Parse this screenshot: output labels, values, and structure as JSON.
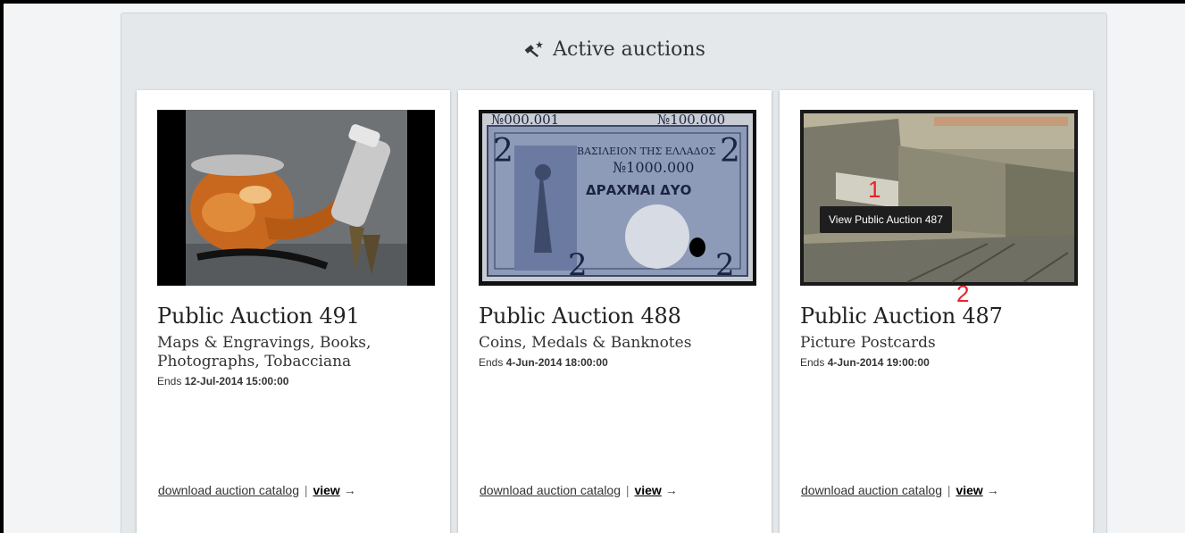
{
  "panel": {
    "title": "Active auctions"
  },
  "cards": [
    {
      "title": "Public Auction 491",
      "subtitle": "Maps & Engravings, Books, Photographs, Tobacciana",
      "ends_label": "Ends",
      "ends_value": "12-Jul-2014 15:00:00",
      "download_label": "download auction catalog",
      "separator": "|",
      "view_label": "view",
      "arrow": "→"
    },
    {
      "title": "Public Auction 488",
      "subtitle": "Coins, Medals & Banknotes",
      "ends_label": "Ends",
      "ends_value": "4-Jun-2014 18:00:00",
      "download_label": "download auction catalog",
      "separator": "|",
      "view_label": "view",
      "arrow": "→"
    },
    {
      "title": "Public Auction 487",
      "subtitle": "Picture Postcards",
      "ends_label": "Ends",
      "ends_value": "4-Jun-2014 19:00:00",
      "download_label": "download auction catalog",
      "separator": "|",
      "view_label": "view",
      "arrow": "→",
      "tooltip": "View Public Auction 487"
    }
  ],
  "markers": {
    "m1": "1",
    "m2": "2"
  },
  "colors": {
    "marker": "#e8232a",
    "panel_bg": "#e4e8eb"
  }
}
